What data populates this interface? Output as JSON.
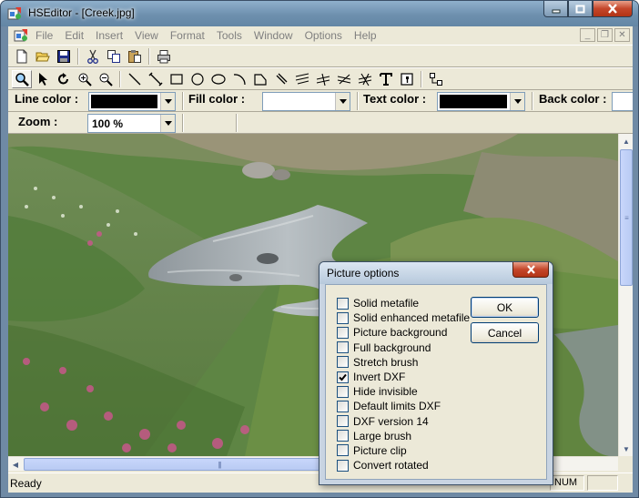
{
  "window": {
    "title": "HSEditor - [Creek.jpg]"
  },
  "menu": {
    "items": [
      "File",
      "Edit",
      "Insert",
      "View",
      "Format",
      "Tools",
      "Window",
      "Options",
      "Help"
    ]
  },
  "toolbar1": {
    "icons": [
      "new-file-icon",
      "open-folder-icon",
      "save-icon",
      "cut-icon",
      "copy-icon",
      "paste-icon",
      "print-icon"
    ]
  },
  "toolbar2": {
    "icons": [
      "zoom-tool-icon",
      "select-arrow-icon",
      "rotate-icon",
      "zoom-in-icon",
      "zoom-out-icon",
      "line-tool-icon",
      "dimension-line-icon",
      "rectangle-tool-icon",
      "circle-tool-icon",
      "ellipse-tool-icon",
      "arc-tool-icon",
      "polygon-tool-icon",
      "pen-tool-icon",
      "freehand-tool-icon",
      "curve-tool-icon",
      "spline-tool-icon",
      "bezier-tool-icon",
      "text-tool-icon",
      "image-insert-icon",
      "link-tool-icon"
    ]
  },
  "properties": {
    "line_color_label": "Line color :",
    "fill_color_label": "Fill color :",
    "text_color_label": "Text color :",
    "back_color_label": "Back color :",
    "line_color": "#000000",
    "fill_color": "#ffffff",
    "text_color": "#000000"
  },
  "zoom": {
    "label": "Zoom :",
    "value": "100 %"
  },
  "status": {
    "text": "Ready",
    "num": "NUM"
  },
  "dialog": {
    "title": "Picture options",
    "ok_label": "OK",
    "cancel_label": "Cancel",
    "options": [
      {
        "label": "Solid metafile",
        "checked": false
      },
      {
        "label": "Solid enhanced metafile",
        "checked": false
      },
      {
        "label": "Picture background",
        "checked": false
      },
      {
        "label": "Full background",
        "checked": false
      },
      {
        "label": "Stretch brush",
        "checked": false
      },
      {
        "label": "Invert DXF",
        "checked": true
      },
      {
        "label": "Hide invisible",
        "checked": false
      },
      {
        "label": "Default limits DXF",
        "checked": false
      },
      {
        "label": "DXF version 14",
        "checked": false
      },
      {
        "label": "Large brush",
        "checked": false
      },
      {
        "label": "Picture clip",
        "checked": false
      },
      {
        "label": "Convert rotated",
        "checked": false
      }
    ]
  }
}
